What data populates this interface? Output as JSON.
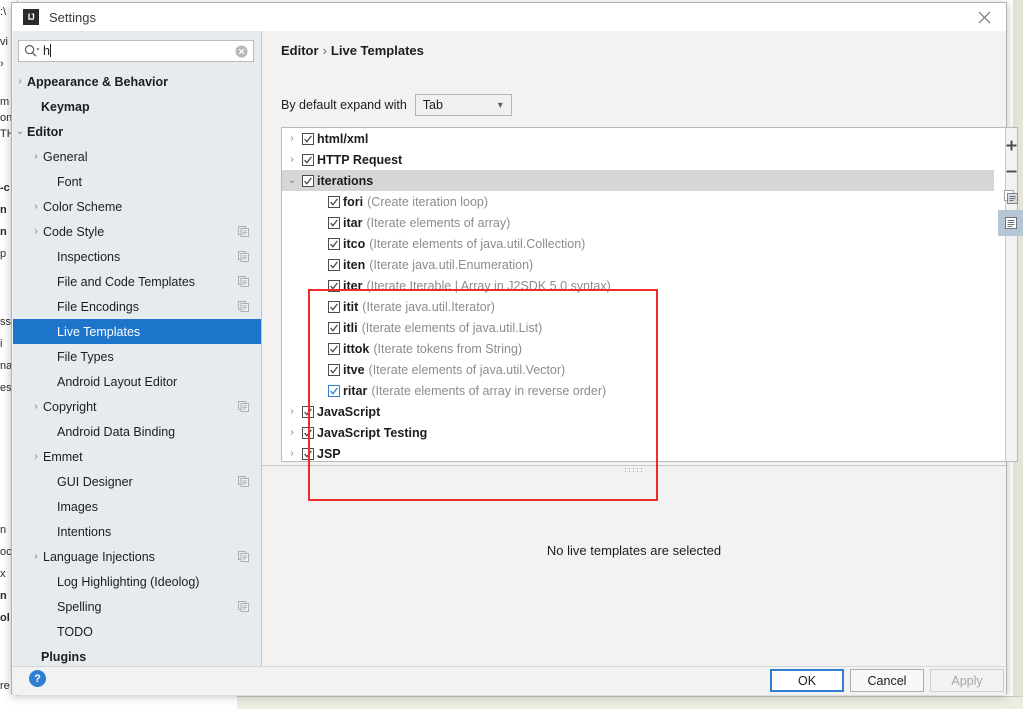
{
  "background": {
    "left_fragments": [
      ":\\",
      "vi",
      "›",
      "m",
      "on",
      "TH",
      "-c",
      "n",
      "n",
      "p",
      "ss",
      "i",
      "na",
      "es",
      "n",
      "oc",
      "x",
      "n",
      "ol",
      "re"
    ]
  },
  "window": {
    "title": "Settings",
    "icon": "intellij-idea-icon",
    "close_icon": "close-icon"
  },
  "search": {
    "value": "h",
    "icon": "search-icon",
    "clear_icon": "clear-icon"
  },
  "tree": {
    "items": [
      {
        "label": "Appearance & Behavior",
        "arrow": "›",
        "bold": true,
        "indent": 8,
        "badge": false,
        "selected": false
      },
      {
        "label": "Keymap",
        "arrow": "",
        "bold": true,
        "indent": 22,
        "badge": false,
        "selected": false
      },
      {
        "label": "Editor",
        "arrow": "⌄",
        "bold": true,
        "indent": 8,
        "badge": false,
        "selected": false
      },
      {
        "label": "General",
        "arrow": "›",
        "bold": false,
        "indent": 24,
        "badge": false,
        "selected": false
      },
      {
        "label": "Font",
        "arrow": "",
        "bold": false,
        "indent": 38,
        "badge": false,
        "selected": false
      },
      {
        "label": "Color Scheme",
        "arrow": "›",
        "bold": false,
        "indent": 24,
        "badge": false,
        "selected": false
      },
      {
        "label": "Code Style",
        "arrow": "›",
        "bold": false,
        "indent": 24,
        "badge": true,
        "selected": false
      },
      {
        "label": "Inspections",
        "arrow": "",
        "bold": false,
        "indent": 38,
        "badge": true,
        "selected": false
      },
      {
        "label": "File and Code Templates",
        "arrow": "",
        "bold": false,
        "indent": 38,
        "badge": true,
        "selected": false
      },
      {
        "label": "File Encodings",
        "arrow": "",
        "bold": false,
        "indent": 38,
        "badge": true,
        "selected": false
      },
      {
        "label": "Live Templates",
        "arrow": "",
        "bold": false,
        "indent": 38,
        "badge": false,
        "selected": true
      },
      {
        "label": "File Types",
        "arrow": "",
        "bold": false,
        "indent": 38,
        "badge": false,
        "selected": false
      },
      {
        "label": "Android Layout Editor",
        "arrow": "",
        "bold": false,
        "indent": 38,
        "badge": false,
        "selected": false
      },
      {
        "label": "Copyright",
        "arrow": "›",
        "bold": false,
        "indent": 24,
        "badge": true,
        "selected": false
      },
      {
        "label": "Android Data Binding",
        "arrow": "",
        "bold": false,
        "indent": 38,
        "badge": false,
        "selected": false
      },
      {
        "label": "Emmet",
        "arrow": "›",
        "bold": false,
        "indent": 24,
        "badge": false,
        "selected": false
      },
      {
        "label": "GUI Designer",
        "arrow": "",
        "bold": false,
        "indent": 38,
        "badge": true,
        "selected": false
      },
      {
        "label": "Images",
        "arrow": "",
        "bold": false,
        "indent": 38,
        "badge": false,
        "selected": false
      },
      {
        "label": "Intentions",
        "arrow": "",
        "bold": false,
        "indent": 38,
        "badge": false,
        "selected": false
      },
      {
        "label": "Language Injections",
        "arrow": "›",
        "bold": false,
        "indent": 24,
        "badge": true,
        "selected": false
      },
      {
        "label": "Log Highlighting (Ideolog)",
        "arrow": "",
        "bold": false,
        "indent": 38,
        "badge": false,
        "selected": false
      },
      {
        "label": "Spelling",
        "arrow": "",
        "bold": false,
        "indent": 38,
        "badge": true,
        "selected": false
      },
      {
        "label": "TODO",
        "arrow": "",
        "bold": false,
        "indent": 38,
        "badge": false,
        "selected": false
      },
      {
        "label": "Plugins",
        "arrow": "",
        "bold": true,
        "indent": 22,
        "badge": false,
        "selected": false
      }
    ]
  },
  "main": {
    "breadcrumb_root": "Editor",
    "breadcrumb_sep": "›",
    "breadcrumb_leaf": "Live Templates",
    "expand_label": "By default expand with",
    "expand_value": "Tab",
    "empty_message": "No live templates are selected",
    "rows": [
      {
        "kind": "group",
        "arrow": "›",
        "label": "html/xml",
        "checked": true,
        "highlight": false
      },
      {
        "kind": "group",
        "arrow": "›",
        "label": "HTTP Request",
        "checked": true,
        "highlight": false
      },
      {
        "kind": "group",
        "arrow": "⌄",
        "label": "iterations",
        "checked": true,
        "highlight": true
      },
      {
        "kind": "template",
        "key": "fori",
        "desc": "(Create iteration loop)",
        "checked": true,
        "focus": false
      },
      {
        "kind": "template",
        "key": "itar",
        "desc": "(Iterate elements of array)",
        "checked": true,
        "focus": false
      },
      {
        "kind": "template",
        "key": "itco",
        "desc": "(Iterate elements of java.util.Collection)",
        "checked": true,
        "focus": false
      },
      {
        "kind": "template",
        "key": "iten",
        "desc": "(Iterate java.util.Enumeration)",
        "checked": true,
        "focus": false
      },
      {
        "kind": "template",
        "key": "iter",
        "desc": "(Iterate Iterable | Array in J2SDK 5.0 syntax)",
        "checked": true,
        "focus": false
      },
      {
        "kind": "template",
        "key": "itit",
        "desc": "(Iterate java.util.Iterator)",
        "checked": true,
        "focus": false
      },
      {
        "kind": "template",
        "key": "itli",
        "desc": "(Iterate elements of java.util.List)",
        "checked": true,
        "focus": false
      },
      {
        "kind": "template",
        "key": "ittok",
        "desc": "(Iterate tokens from String)",
        "checked": true,
        "focus": false
      },
      {
        "kind": "template",
        "key": "itve",
        "desc": "(Iterate elements of java.util.Vector)",
        "checked": true,
        "focus": false
      },
      {
        "kind": "template",
        "key": "ritar",
        "desc": "(Iterate elements of array in reverse order)",
        "checked": true,
        "focus": true
      },
      {
        "kind": "group",
        "arrow": "›",
        "label": "JavaScript",
        "checked": true,
        "highlight": false
      },
      {
        "kind": "group",
        "arrow": "›",
        "label": "JavaScript Testing",
        "checked": true,
        "highlight": false
      },
      {
        "kind": "group",
        "arrow": "›",
        "label": "JSP",
        "checked": true,
        "highlight": false
      }
    ],
    "toolbar": [
      {
        "name": "add-button",
        "glyph": "+",
        "active": false
      },
      {
        "name": "remove-button",
        "glyph": "−",
        "active": false
      },
      {
        "name": "copy-button",
        "glyph": "copy-icon",
        "active": false
      },
      {
        "name": "duplicate-group-button",
        "glyph": "list-icon",
        "active": true
      }
    ]
  },
  "footer": {
    "help_icon": "?",
    "ok_label": "OK",
    "cancel_label": "Cancel",
    "apply_label": "Apply"
  },
  "colors": {
    "accent_blue": "#1c74cb",
    "annotation_red": "#ef2d28",
    "dialog_bg": "#f2f2f2",
    "tree_bg": "#e6ebef"
  }
}
